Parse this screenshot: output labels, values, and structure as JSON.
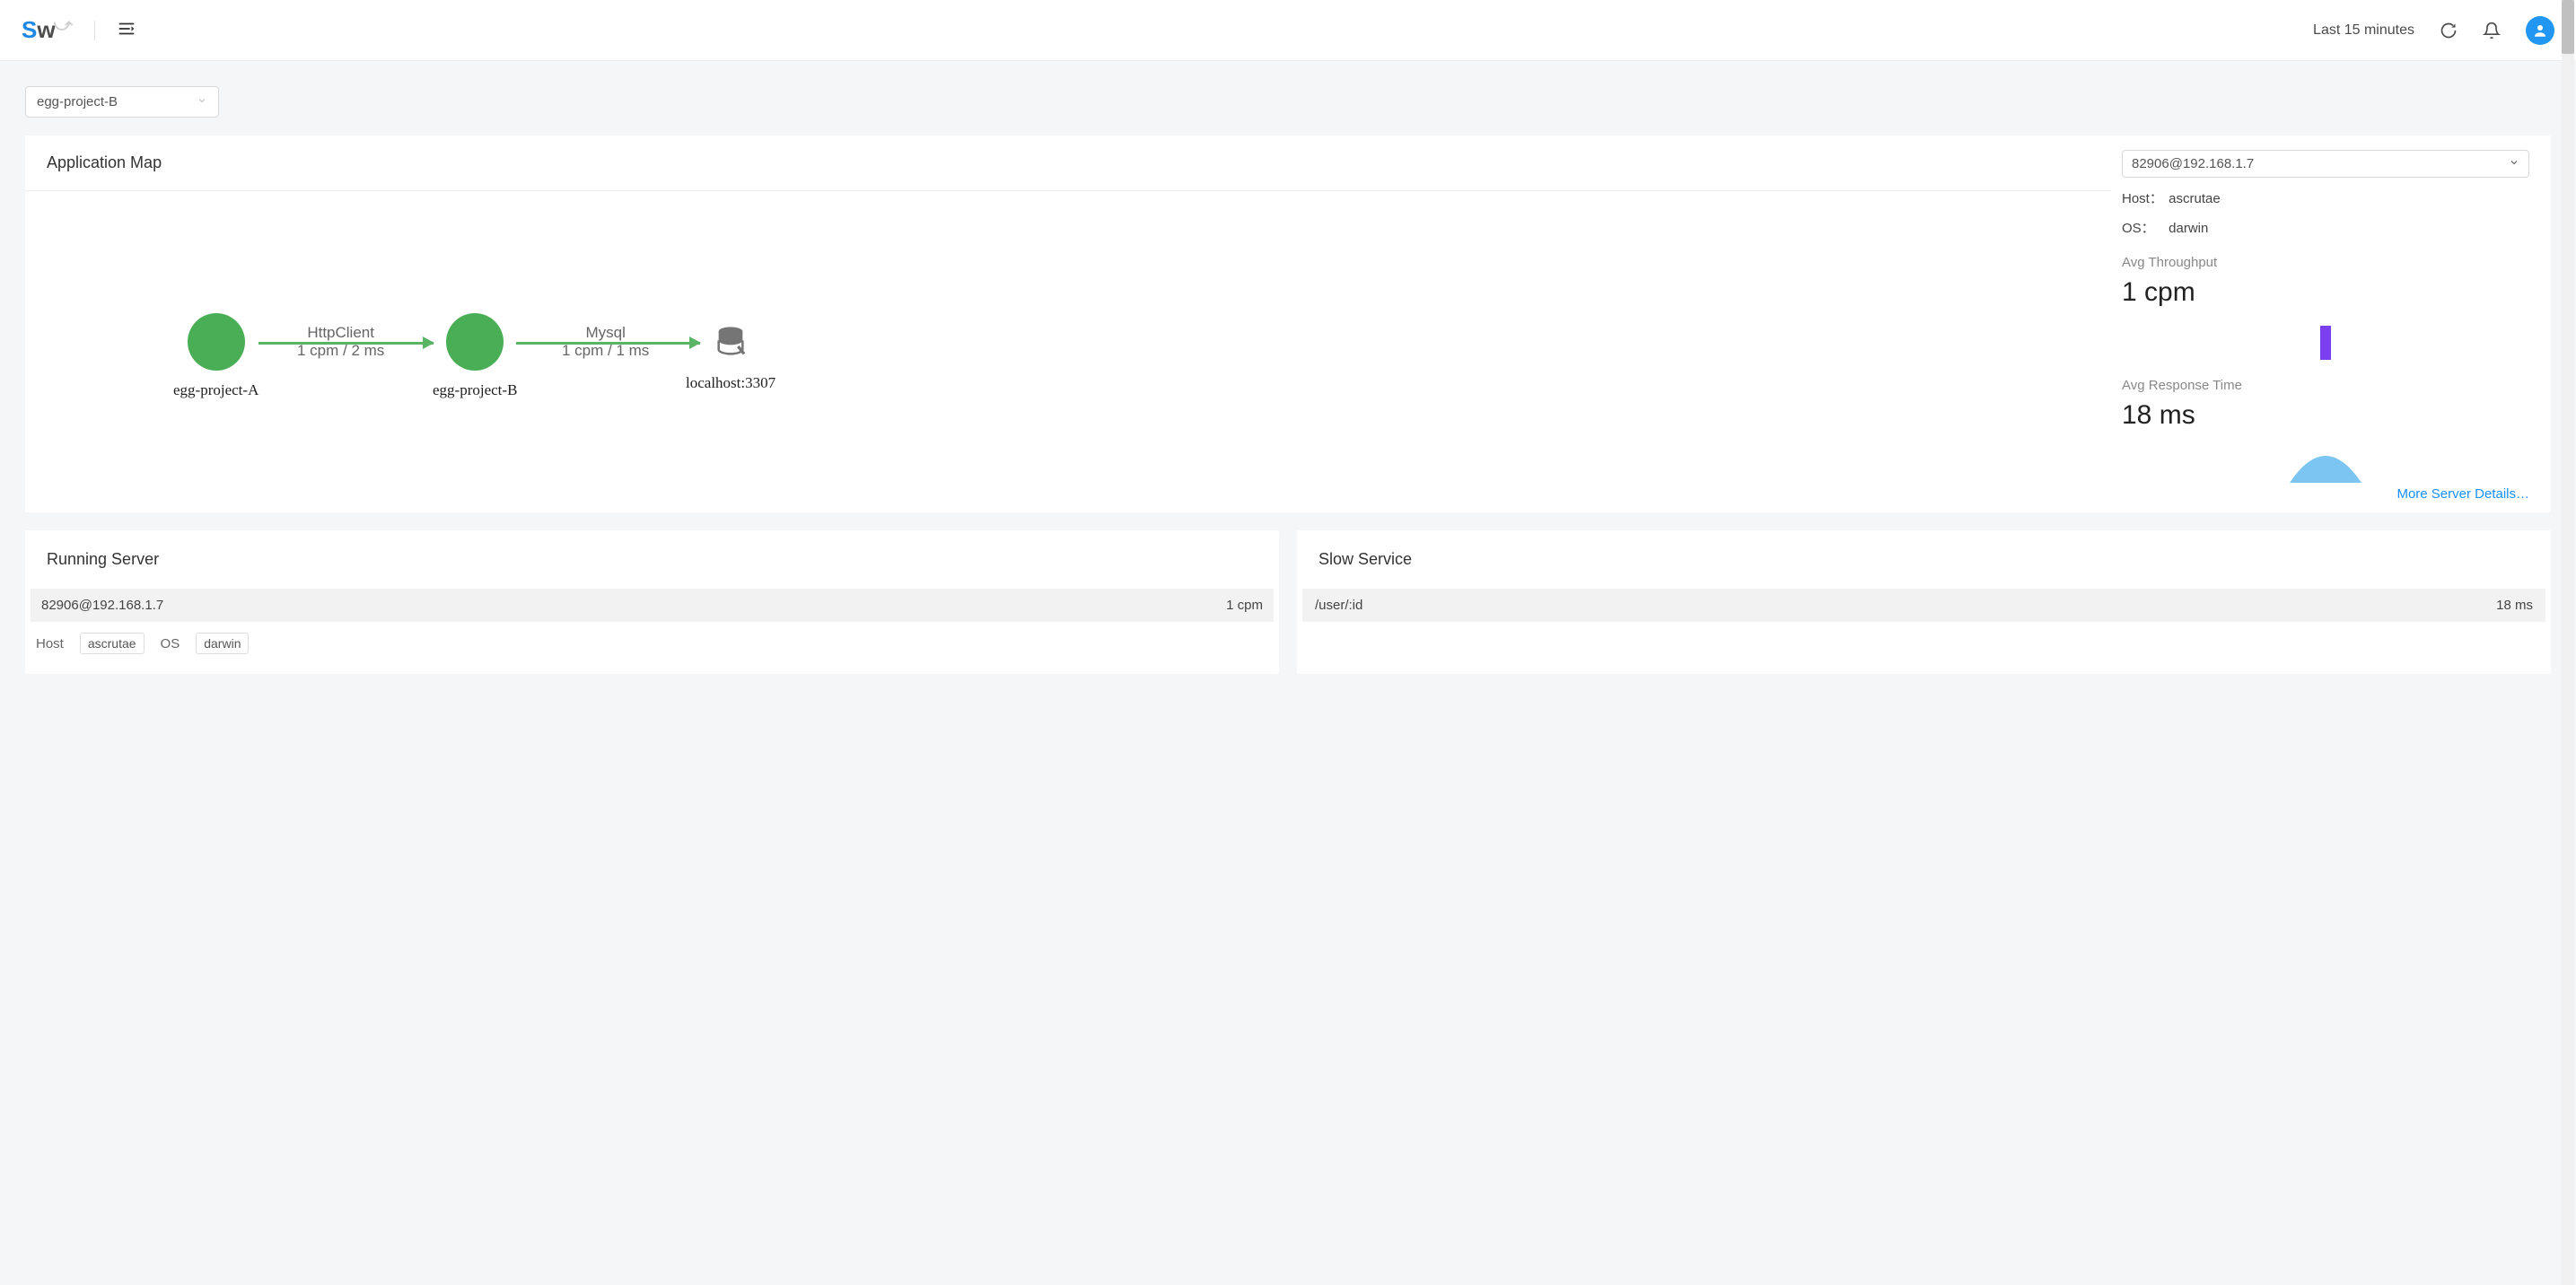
{
  "header": {
    "time_range": "Last 15 minutes"
  },
  "filter": {
    "selected_project": "egg-project-B"
  },
  "app_map": {
    "title": "Application Map",
    "nodes": {
      "a": {
        "label": "egg-project-A"
      },
      "b": {
        "label": "egg-project-B"
      },
      "db": {
        "label": "localhost:3307"
      }
    },
    "edges": {
      "ab": {
        "protocol": "HttpClient",
        "stats": "1 cpm / 2 ms"
      },
      "bdb": {
        "protocol": "Mysql",
        "stats": "1 cpm / 1 ms"
      }
    }
  },
  "instance": {
    "selected": "82906@192.168.1.7",
    "host_label": "Host：",
    "host_value": "ascrutae",
    "os_label": "OS：",
    "os_value": "darwin",
    "throughput_label": "Avg Throughput",
    "throughput_value": "1 cpm",
    "response_label": "Avg Response Time",
    "response_value": "18 ms",
    "more_link": "More Server Details…"
  },
  "running_server": {
    "title": "Running Server",
    "rows": [
      {
        "name": "82906@192.168.1.7",
        "metric": "1 cpm",
        "host_label": "Host",
        "host_value": "ascrutae",
        "os_label": "OS",
        "os_value": "darwin"
      }
    ]
  },
  "slow_service": {
    "title": "Slow Service",
    "rows": [
      {
        "path": "/user/:id",
        "latency": "18 ms"
      }
    ]
  }
}
